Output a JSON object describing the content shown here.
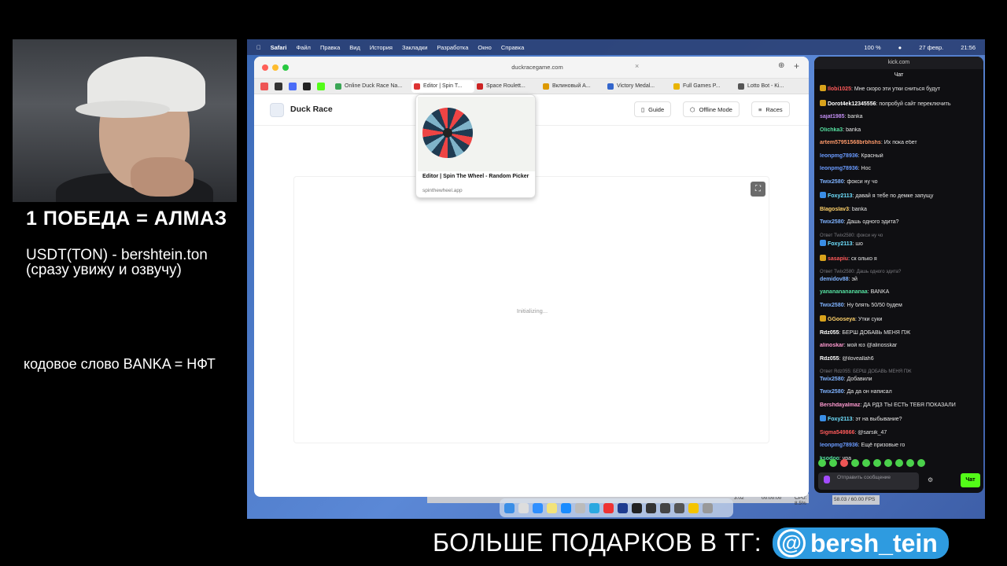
{
  "overlay": {
    "promo_title": "1 ПОБЕДА = АЛМАЗ",
    "wallet_line": "USDT(TON) - bershtein.ton",
    "wallet_note": "(сразу увижу и озвучу)",
    "code_word": "кодовое слово BANKA = НФТ",
    "bottom_banner": "БОЛЬШЕ ПОДАРКОВ В ТГ:",
    "telegram_handle": "bersh_tein",
    "telegram_at": "@"
  },
  "menubar": {
    "app": "Safari",
    "items": [
      "Файл",
      "Правка",
      "Вид",
      "История",
      "Закладки",
      "Разработка",
      "Окно",
      "Справка"
    ],
    "battery": "100 %",
    "date": "27 февр.",
    "time": "21:56"
  },
  "browser": {
    "url": "duckracegame.com",
    "tabs": [
      {
        "label": "Online Duck Race Na...",
        "color": "#3aa655"
      },
      {
        "label": "Editor | Spin T...",
        "color": "#d33"
      },
      {
        "label": "Space Roulett...",
        "color": "#c22"
      },
      {
        "label": "Вклиновый А...",
        "color": "#d90"
      },
      {
        "label": "Victory Medal...",
        "color": "#36c"
      },
      {
        "label": "Full Games P...",
        "color": "#e9b400"
      },
      {
        "label": "Lotto Bot - Ki...",
        "color": "#555"
      }
    ],
    "preview": {
      "title": "Editor | Spin The Wheel - Random Picker",
      "domain": "spinthewheel.app"
    }
  },
  "site": {
    "title": "Duck Race",
    "guide": "Guide",
    "offline": "Offline Mode",
    "races": "Races",
    "status": "Initializing..."
  },
  "chat": {
    "domain": "kick.com",
    "label": "Чат",
    "input_placeholder": "Отправить сообщение",
    "send_label": "Чат",
    "messages": [
      {
        "user": "Ilobi1025",
        "text": "Мне скоро эти утки сниться будут",
        "color": "#ff5a5a",
        "badge": "#d8a21c"
      },
      {
        "user": "Dorot4ek12345556",
        "text": "попробуй сайт переключить",
        "color": "#ffffff",
        "badge": "#d8a21c"
      },
      {
        "user": "sajat1985",
        "text": "banka",
        "color": "#c08cf0",
        "badge": ""
      },
      {
        "user": "Olichka3",
        "text": "banka",
        "color": "#55e0a0",
        "badge": ""
      },
      {
        "user": "artem57951568brbhshs",
        "text": "Их пока ебет",
        "color": "#ff9a6a",
        "badge": ""
      },
      {
        "user": "leonpmg78936",
        "text": "Красный",
        "color": "#6a9bff",
        "badge": ""
      },
      {
        "user": "leonpmg78936",
        "text": "Нос",
        "color": "#6a9bff",
        "badge": ""
      },
      {
        "user": "Twix2580",
        "text": "фокси ну чо",
        "color": "#7fb3ff",
        "badge": ""
      },
      {
        "user": "Foxy2113",
        "text": "давай я тебе по демке запущу",
        "color": "#6ee0ff",
        "badge": "#3a8ee6"
      },
      {
        "user": "Blagoslav3",
        "text": "banka",
        "color": "#ffd26a",
        "badge": ""
      },
      {
        "user": "Twix2580",
        "text": "Дашь одного эдита?",
        "color": "#7fb3ff",
        "badge": ""
      },
      {
        "reply": "Ответ Twix2580: фокси ну чо",
        "user": "Foxy2113",
        "text": "шо",
        "color": "#6ee0ff",
        "badge": "#3a8ee6"
      },
      {
        "user": "sasapiu",
        "text": "ск олько я",
        "color": "#ff5a5a",
        "badge": "#d8a21c"
      },
      {
        "reply": "Ответ Twix2580: Дашь одного эдита?",
        "user": "demidov88",
        "text": "эй",
        "color": "#7fb3ff",
        "badge": ""
      },
      {
        "user": "yananananananaa",
        "text": "BANKA",
        "color": "#55e0a0",
        "badge": ""
      },
      {
        "user": "Twix2580",
        "text": "Ну блять 50/50 будем",
        "color": "#7fb3ff",
        "badge": ""
      },
      {
        "user": "GGooseya",
        "text": "Утки суки",
        "color": "#ffd26a",
        "badge": "#d8a21c"
      },
      {
        "user": "Rdz055",
        "text": "БЕРШ ДОБАВЬ МЕНЯ ПЖ",
        "color": "#ffffff",
        "badge": ""
      },
      {
        "user": "alinoskar",
        "text": "мой юз @alinosskar",
        "color": "#ff9ad0",
        "badge": ""
      },
      {
        "user": "Rdz055",
        "text": "@iloveallah6",
        "color": "#ffffff",
        "badge": ""
      },
      {
        "reply": "Ответ Rdz055: БЕРШ ДОБАВЬ МЕНЯ ПЖ",
        "user": "Twix2580",
        "text": "Добавили",
        "color": "#7fb3ff",
        "badge": ""
      },
      {
        "user": "Twix2580",
        "text": "Да да он написал",
        "color": "#7fb3ff",
        "badge": ""
      },
      {
        "user": "Bershdayalmaz",
        "text": "ДА РДЗ ТЫ ЕСТЬ ТЕБЯ ПОКАЗАЛИ",
        "color": "#ff9ad0",
        "badge": ""
      },
      {
        "user": "Foxy2113",
        "text": "эт на выбывание?",
        "color": "#6ee0ff",
        "badge": "#3a8ee6"
      },
      {
        "user": "Sigma549866",
        "text": "@sarsik_47",
        "color": "#ff5a5a",
        "badge": ""
      },
      {
        "user": "leonpmg78936",
        "text": "Ещё призовые го",
        "color": "#6a9bff",
        "badge": ""
      },
      {
        "user": "ksodoo",
        "text": "ура",
        "color": "#55e0a0",
        "badge": ""
      }
    ]
  },
  "obs": {
    "time": "00:00:00",
    "cpu": "CPU: 8.5%",
    "fps": "58.03 / 60.00 FPS",
    "val": "3.02"
  }
}
